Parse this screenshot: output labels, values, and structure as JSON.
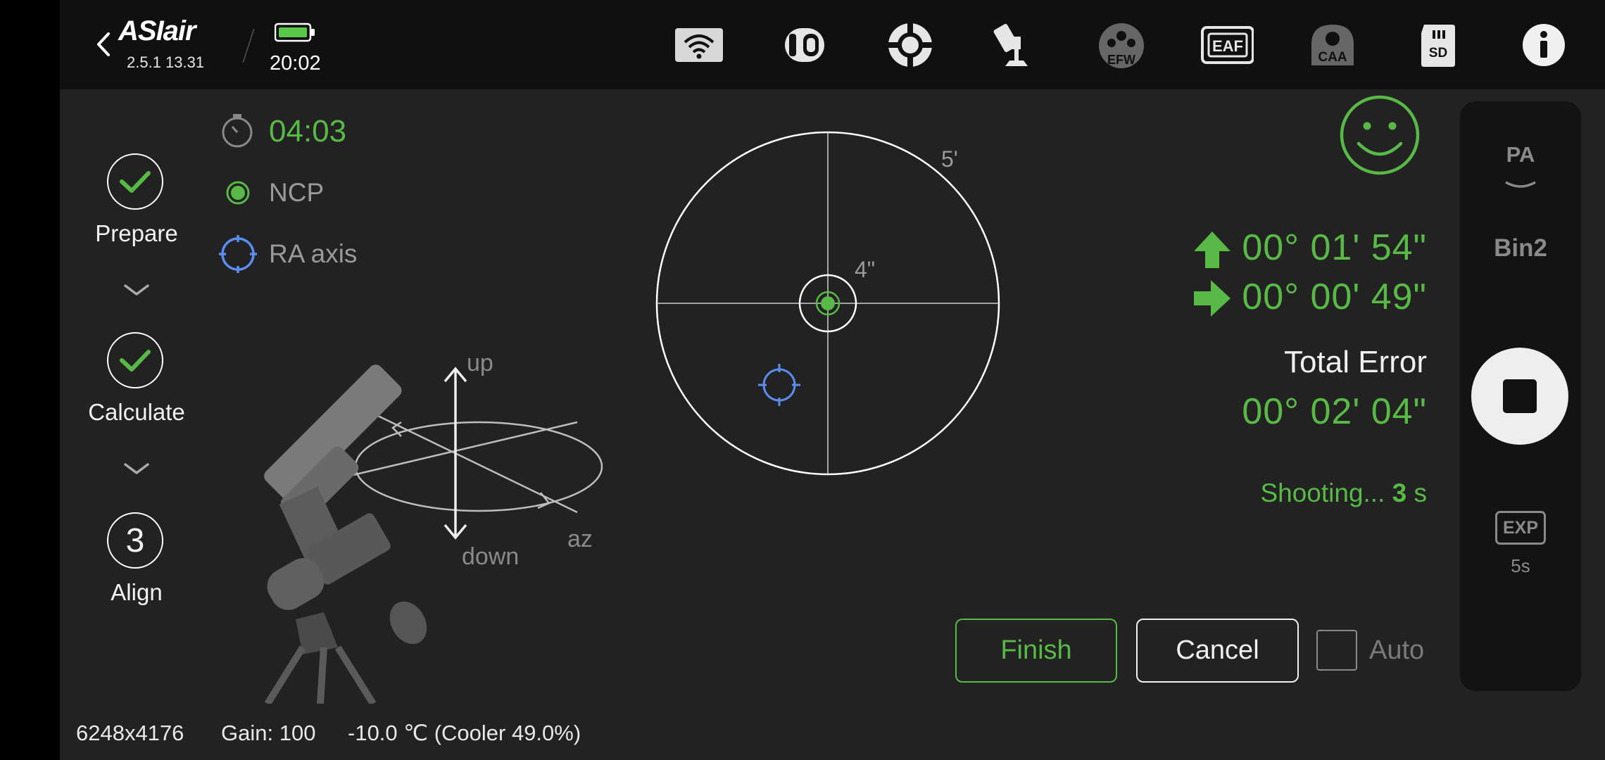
{
  "app": {
    "name": "ASIair",
    "version": "2.5.1 13.31",
    "clock": "20:02"
  },
  "toolbar": {
    "icons": [
      {
        "name": "wifi-icon"
      },
      {
        "name": "camera-icon"
      },
      {
        "name": "guide-icon"
      },
      {
        "name": "mount-icon"
      },
      {
        "name": "efw-icon",
        "label": "EFW"
      },
      {
        "name": "eaf-icon",
        "label": "EAF"
      },
      {
        "name": "caa-icon",
        "label": "CAA"
      },
      {
        "name": "sd-card-icon",
        "label": "SD"
      },
      {
        "name": "info-icon"
      }
    ]
  },
  "status": {
    "timer": "04:03",
    "target_label": "NCP",
    "axis_label": "RA axis"
  },
  "steps": [
    {
      "label": "Prepare",
      "state": "done"
    },
    {
      "label": "Calculate",
      "state": "done"
    },
    {
      "label": "Align",
      "state": "active",
      "number": "3"
    }
  ],
  "diagram": {
    "up": "up",
    "down": "down",
    "az": "az"
  },
  "target": {
    "outer_label": "5'",
    "inner_label": "4\""
  },
  "errors": {
    "altitude": "00° 01' 54\"",
    "azimuth": "00° 00' 49\"",
    "total_label": "Total Error",
    "total": "00° 02' 04\""
  },
  "shooting": {
    "prefix": "Shooting... ",
    "seconds": "3",
    "unit": " s"
  },
  "buttons": {
    "finish": "Finish",
    "cancel": "Cancel",
    "auto": "Auto",
    "auto_checked": false
  },
  "side_panel": {
    "mode": "PA",
    "bin": "Bin2",
    "exp_label": "EXP",
    "exp_value": "5s"
  },
  "footer": {
    "resolution": "6248x4176",
    "gain": "Gain: 100",
    "temperature": "-10.0 ℃ (Cooler 49.0%)"
  },
  "colors": {
    "accent_green": "#58b947",
    "ra_blue": "#5b8df0"
  }
}
